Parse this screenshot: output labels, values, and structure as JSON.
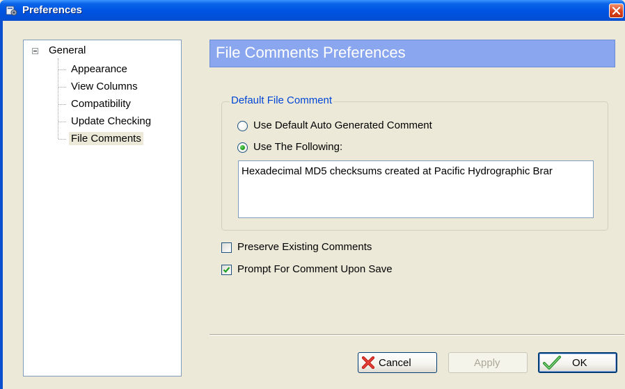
{
  "window": {
    "title": "Preferences",
    "icon": "preferences-app-icon",
    "close_icon": "close-icon"
  },
  "tree": {
    "root": {
      "label": "General",
      "expanded": true
    },
    "items": [
      {
        "label": "Appearance",
        "selected": false
      },
      {
        "label": "View Columns",
        "selected": false
      },
      {
        "label": "Compatibility",
        "selected": false
      },
      {
        "label": "Update Checking",
        "selected": false
      },
      {
        "label": "File Comments",
        "selected": true
      }
    ]
  },
  "header": {
    "title": "File Comments Preferences"
  },
  "group": {
    "legend": "Default File Comment",
    "option_auto": {
      "label": "Use Default Auto Generated Comment",
      "checked": false
    },
    "option_following": {
      "label": "Use The Following:",
      "checked": true
    },
    "comment_text": "Hexadecimal MD5 checksums created at Pacific Hydrographic Brar"
  },
  "options": {
    "preserve": {
      "label": "Preserve Existing Comments",
      "checked": false
    },
    "prompt": {
      "label": "Prompt For Comment Upon Save",
      "checked": true
    }
  },
  "buttons": {
    "cancel": {
      "label": "Cancel",
      "icon": "red-x-icon"
    },
    "apply": {
      "label": "Apply",
      "enabled": false
    },
    "ok": {
      "label": "OK",
      "icon": "green-checkmark-icon"
    }
  },
  "colors": {
    "titlebar": "#0054e3",
    "header_band": "#8aa6ee",
    "legend": "#0046d5",
    "face": "#ece9d8"
  }
}
